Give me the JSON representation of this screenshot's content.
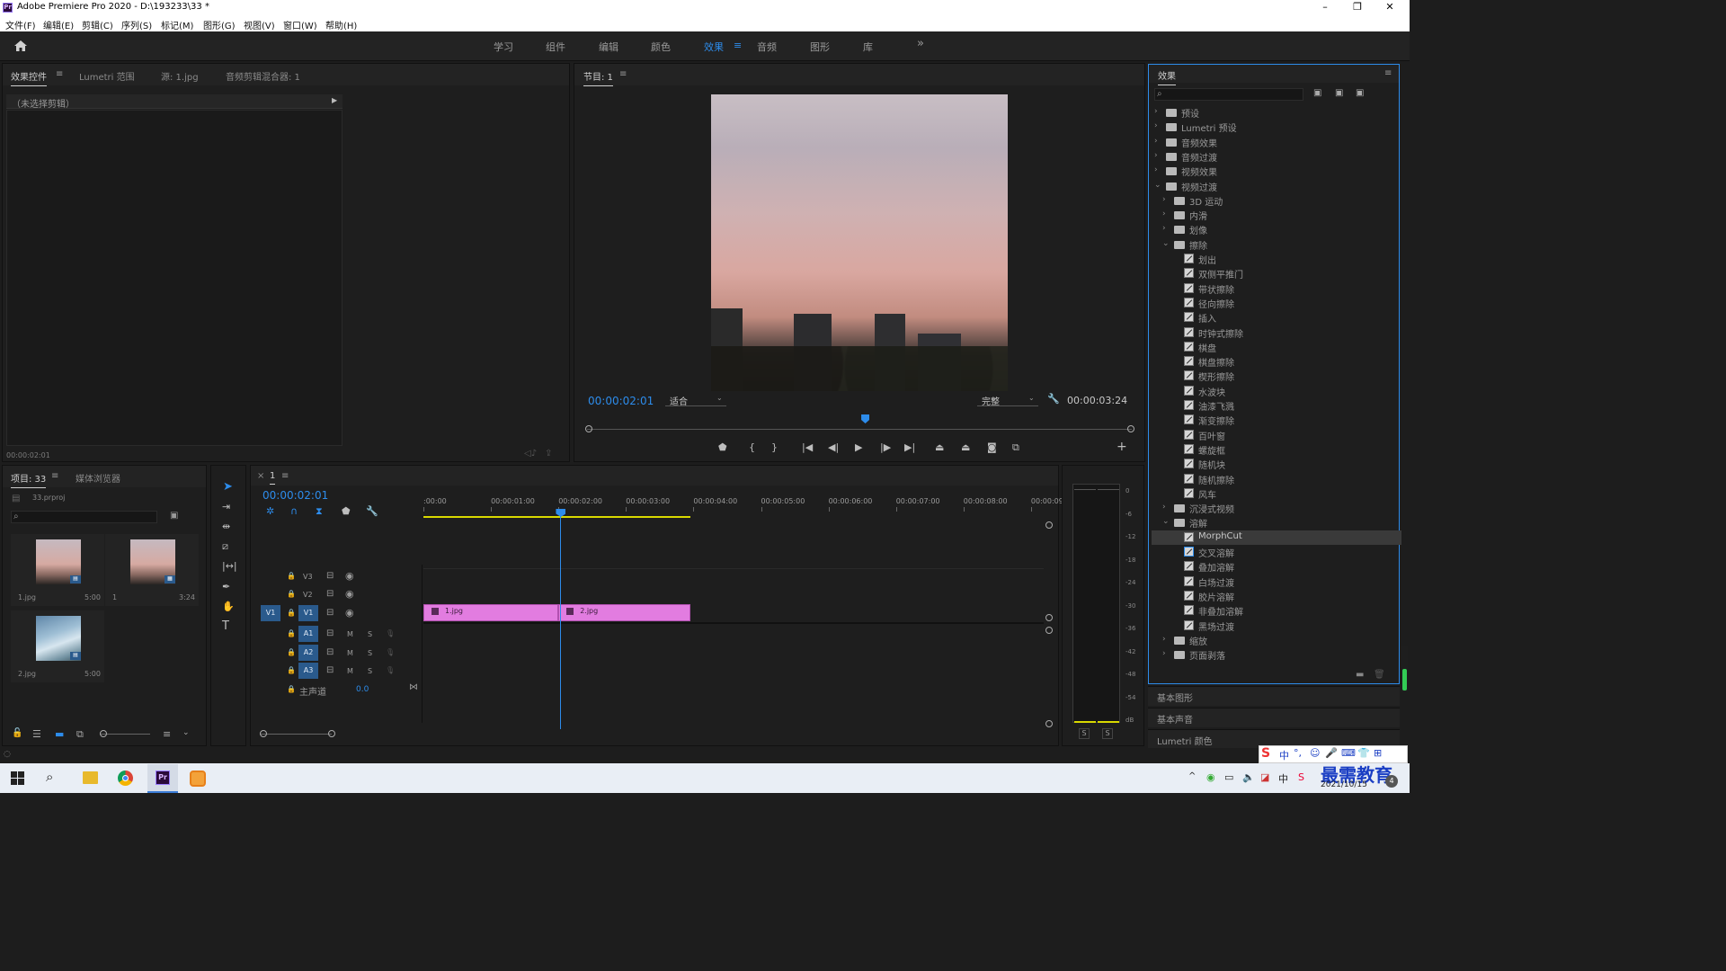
{
  "app": {
    "title": "Adobe Premiere Pro 2020 - D:\\193233\\33 *",
    "logo": "Pr",
    "window_controls": {
      "minimize": "–",
      "maximize": "❐",
      "close": "✕"
    }
  },
  "menu": [
    "文件(F)",
    "编辑(E)",
    "剪辑(C)",
    "序列(S)",
    "标记(M)",
    "图形(G)",
    "视图(V)",
    "窗口(W)",
    "帮助(H)"
  ],
  "workspaces": {
    "items": [
      "学习",
      "组件",
      "编辑",
      "颜色",
      "效果",
      "音频",
      "图形",
      "库"
    ],
    "active": "效果",
    "more": "»"
  },
  "source_panel": {
    "tabs": [
      "效果控件",
      "Lumetri 范围",
      "源: 1.jpg",
      "音频剪辑混合器: 1"
    ],
    "no_clip": "（未选择剪辑）",
    "timecode": "00:00:02:01"
  },
  "program_panel": {
    "title": "节目: 1",
    "timecode_current": "00:00:02:01",
    "fit_option": "适合",
    "quality_option": "完整",
    "timecode_duration": "00:00:03:24",
    "playhead_fraction": 0.51
  },
  "project_panel": {
    "tabs": [
      "项目: 33",
      "媒体浏览器"
    ],
    "file": "33.prproj",
    "items": [
      {
        "name": "1.jpg",
        "duration": "5:00"
      },
      {
        "name": "1",
        "duration": "3:24"
      },
      {
        "name": "2.jpg",
        "duration": "5:00"
      }
    ]
  },
  "timeline": {
    "tab": "1",
    "timecode": "00:00:02:01",
    "ruler": [
      ":00:00",
      "00:00:01:00",
      "00:00:02:00",
      "00:00:03:00",
      "00:00:04:00",
      "00:00:05:00",
      "00:00:06:00",
      "00:00:07:00",
      "00:00:08:00",
      "00:00:09:"
    ],
    "video_tracks": [
      "V3",
      "V2",
      "V1"
    ],
    "audio_tracks": [
      "A1",
      "A2",
      "A3"
    ],
    "source_patch": "V1",
    "mute": "M",
    "solo": "S",
    "master_label": "主声道",
    "master_value": "0.0",
    "clips": [
      {
        "name": "1.jpg",
        "start_sec": 0,
        "end_sec": 2.0
      },
      {
        "name": "2.jpg",
        "start_sec": 2.0,
        "end_sec": 3.96
      }
    ],
    "playhead_sec": 2.03
  },
  "audio_meter": {
    "scale": [
      "0",
      "-6",
      "-12",
      "-18",
      "-24",
      "-30",
      "-36",
      "-42",
      "-48",
      "-54",
      "dB"
    ],
    "solo": [
      "S",
      "S"
    ]
  },
  "effects_panel": {
    "title": "效果",
    "search_placeholder": "",
    "tree": [
      {
        "label": "预设",
        "level": 0,
        "type": "folder",
        "open": false
      },
      {
        "label": "Lumetri 预设",
        "level": 0,
        "type": "folder",
        "open": false
      },
      {
        "label": "音频效果",
        "level": 0,
        "type": "folder",
        "open": false
      },
      {
        "label": "音频过渡",
        "level": 0,
        "type": "folder",
        "open": false
      },
      {
        "label": "视频效果",
        "level": 0,
        "type": "folder",
        "open": false
      },
      {
        "label": "视频过渡",
        "level": 0,
        "type": "folder",
        "open": true
      },
      {
        "label": "3D 运动",
        "level": 1,
        "type": "folder",
        "open": false
      },
      {
        "label": "内滑",
        "level": 1,
        "type": "folder",
        "open": false
      },
      {
        "label": "划像",
        "level": 1,
        "type": "folder",
        "open": false
      },
      {
        "label": "擦除",
        "level": 1,
        "type": "folder",
        "open": true
      },
      {
        "label": "划出",
        "level": 2,
        "type": "fx"
      },
      {
        "label": "双侧平推门",
        "level": 2,
        "type": "fx"
      },
      {
        "label": "带状擦除",
        "level": 2,
        "type": "fx"
      },
      {
        "label": "径向擦除",
        "level": 2,
        "type": "fx"
      },
      {
        "label": "插入",
        "level": 2,
        "type": "fx"
      },
      {
        "label": "时钟式擦除",
        "level": 2,
        "type": "fx"
      },
      {
        "label": "棋盘",
        "level": 2,
        "type": "fx"
      },
      {
        "label": "棋盘擦除",
        "level": 2,
        "type": "fx"
      },
      {
        "label": "楔形擦除",
        "level": 2,
        "type": "fx"
      },
      {
        "label": "水波块",
        "level": 2,
        "type": "fx"
      },
      {
        "label": "油漆飞溅",
        "level": 2,
        "type": "fx"
      },
      {
        "label": "渐变擦除",
        "level": 2,
        "type": "fx"
      },
      {
        "label": "百叶窗",
        "level": 2,
        "type": "fx"
      },
      {
        "label": "螺旋框",
        "level": 2,
        "type": "fx"
      },
      {
        "label": "随机块",
        "level": 2,
        "type": "fx"
      },
      {
        "label": "随机擦除",
        "level": 2,
        "type": "fx"
      },
      {
        "label": "风车",
        "level": 2,
        "type": "fx"
      },
      {
        "label": "沉浸式视频",
        "level": 1,
        "type": "folder",
        "open": false
      },
      {
        "label": "溶解",
        "level": 1,
        "type": "folder",
        "open": true
      },
      {
        "label": "MorphCut",
        "level": 2,
        "type": "fx",
        "selected": true
      },
      {
        "label": "交叉溶解",
        "level": 2,
        "type": "fx",
        "highlight": true
      },
      {
        "label": "叠加溶解",
        "level": 2,
        "type": "fx"
      },
      {
        "label": "白场过渡",
        "level": 2,
        "type": "fx"
      },
      {
        "label": "胶片溶解",
        "level": 2,
        "type": "fx"
      },
      {
        "label": "非叠加溶解",
        "level": 2,
        "type": "fx"
      },
      {
        "label": "黑场过渡",
        "level": 2,
        "type": "fx"
      },
      {
        "label": "缩放",
        "level": 1,
        "type": "folder",
        "open": false
      },
      {
        "label": "页面剥落",
        "level": 1,
        "type": "folder",
        "open": false
      }
    ],
    "bottom_sections": [
      "基本图形",
      "基本声音",
      "Lumetri 颜色"
    ]
  },
  "taskbar": {
    "ime": "中",
    "brand": "最需教育",
    "date": "2021/10/15",
    "apps": [
      "windows-start-icon",
      "search-icon",
      "file-explorer-icon",
      "chrome-icon",
      "premiere-icon",
      "app-icon"
    ]
  },
  "colors": {
    "accent_blue": "#2d8ceb",
    "clip_pink": "#e27ce0",
    "work_area_yellow": "#d9d900",
    "track_badge": "#2a5a8c"
  }
}
